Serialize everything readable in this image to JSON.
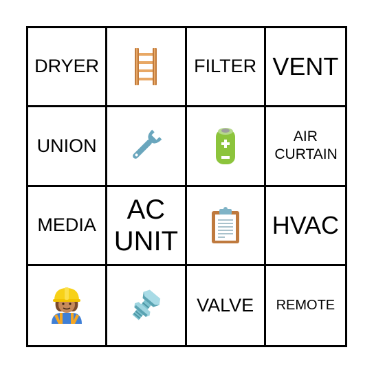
{
  "board": {
    "cells": [
      {
        "type": "text",
        "text": "DRYER"
      },
      {
        "type": "icon",
        "icon": "ladder-icon"
      },
      {
        "type": "text",
        "text": "FILTER"
      },
      {
        "type": "text",
        "text": "VENT"
      },
      {
        "type": "text",
        "text": "UNION"
      },
      {
        "type": "icon",
        "icon": "wrench-icon"
      },
      {
        "type": "icon",
        "icon": "battery-icon"
      },
      {
        "type": "text",
        "text": "AIR CURTAIN"
      },
      {
        "type": "text",
        "text": "MEDIA"
      },
      {
        "type": "text",
        "text": "AC UNIT"
      },
      {
        "type": "icon",
        "icon": "clipboard-icon"
      },
      {
        "type": "text",
        "text": "HVAC"
      },
      {
        "type": "icon",
        "icon": "construction-worker-icon"
      },
      {
        "type": "icon",
        "icon": "nut-and-bolt-icon"
      },
      {
        "type": "text",
        "text": "VALVE"
      },
      {
        "type": "text",
        "text": "REMOTE"
      }
    ]
  }
}
